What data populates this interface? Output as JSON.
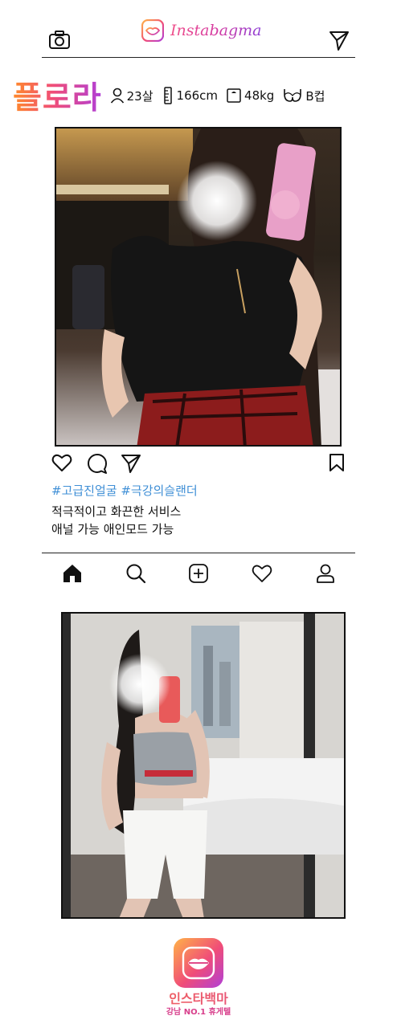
{
  "header": {
    "brand": "Instabagma",
    "logo_icon": "lips-icon",
    "left_icon": "camera-icon",
    "right_icon": "send-icon"
  },
  "profile": {
    "name": "플로라",
    "age": "23살",
    "height": "166cm",
    "weight": "48kg",
    "cup": "B컵"
  },
  "post": {
    "hashtags": "#고급진얼굴 #극강의슬랜더",
    "caption_line1": "적극적이고 화끈한 서비스",
    "caption_line2": "애널 가능 애인모드 가능"
  },
  "nav": [
    "home-icon",
    "search-icon",
    "add-icon",
    "heart-icon",
    "profile-icon"
  ],
  "footer": {
    "name": "인스타백마",
    "sub": "강남 NO.1 휴게텔"
  },
  "colors": {
    "brand_orange": "#ff8a2a",
    "brand_pink": "#f04d78",
    "brand_purple": "#b03fd8",
    "hashtag_blue": "#3f8fd6"
  }
}
